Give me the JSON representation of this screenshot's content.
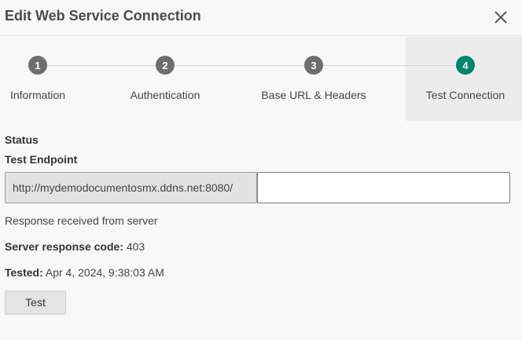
{
  "dialog": {
    "title": "Edit Web Service Connection",
    "close_icon": "close-icon"
  },
  "stepper": {
    "active_color": "#00866b",
    "inactive_color": "#6e6e6e",
    "steps": [
      {
        "number": "1",
        "label": "Information",
        "active": false
      },
      {
        "number": "2",
        "label": "Authentication",
        "active": false
      },
      {
        "number": "3",
        "label": "Base URL & Headers",
        "active": false
      },
      {
        "number": "4",
        "label": "Test Connection",
        "active": true
      }
    ]
  },
  "content": {
    "status_heading": "Status",
    "endpoint_label": "Test Endpoint",
    "endpoint_base_url": "http://mydemodocumentosmx.ddns.net:8080/",
    "endpoint_path_value": "",
    "response_message": "Response received from server",
    "response_code_label": "Server response code:",
    "response_code_value": "403",
    "tested_label": "Tested:",
    "tested_value": "Apr 4, 2024, 9:38:03 AM",
    "test_button_label": "Test"
  }
}
